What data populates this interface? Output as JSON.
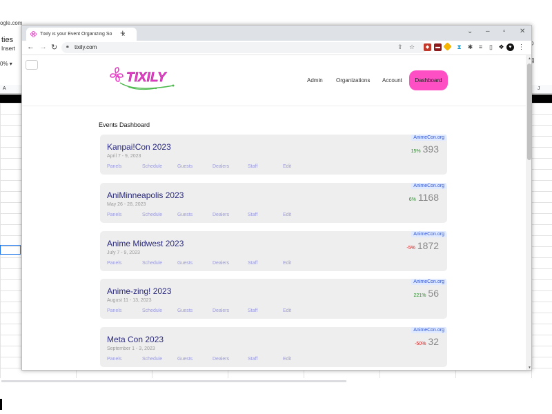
{
  "background_app": {
    "url_fragment": "ogle.com",
    "menu_title": "ties",
    "menu_insert": "Insert",
    "zoom": "0%",
    "col_a": "A",
    "col_j": "J"
  },
  "browser": {
    "tab_title": "Tixily is your Event Organizing So",
    "tab_close": "×",
    "new_tab": "+",
    "url": "tixily.com"
  },
  "site": {
    "brand": "TIXILY",
    "brand_color": "#e83fc8",
    "accent_green": "#4ab84a",
    "nav": {
      "admin": "Admin",
      "organizations": "Organizations",
      "account": "Account",
      "dashboard": "Dashboard"
    },
    "dashboard_button_color": "#ff4fc4"
  },
  "dashboard": {
    "heading": "Events Dashboard",
    "link_labels": [
      "Panels",
      "Schedule",
      "Guests",
      "Dealers",
      "Staff",
      "Edit"
    ],
    "events": [
      {
        "title": "Kanpai!Con 2023",
        "date": "April 7 - 9, 2023",
        "badge": "AnimeCon.org",
        "pct": "15%",
        "count": "393",
        "trend": "up"
      },
      {
        "title": "AniMinneapolis 2023",
        "date": "May 26 - 28, 2023",
        "badge": "AnimeCon.org",
        "pct": "6%",
        "count": "1168",
        "trend": "up"
      },
      {
        "title": "Anime Midwest 2023",
        "date": "July 7 - 9, 2023",
        "badge": "AnimeCon.org",
        "pct": "-5%",
        "count": "1872",
        "trend": "down"
      },
      {
        "title": "Anime-zing! 2023",
        "date": "August 11 - 13, 2023",
        "badge": "AnimeCon.org",
        "pct": "221%",
        "count": "56",
        "trend": "up"
      },
      {
        "title": "Meta Con 2023",
        "date": "September 1 - 3, 2023",
        "badge": "AnimeCon.org",
        "pct": "-50%",
        "count": "32",
        "trend": "down"
      }
    ]
  }
}
